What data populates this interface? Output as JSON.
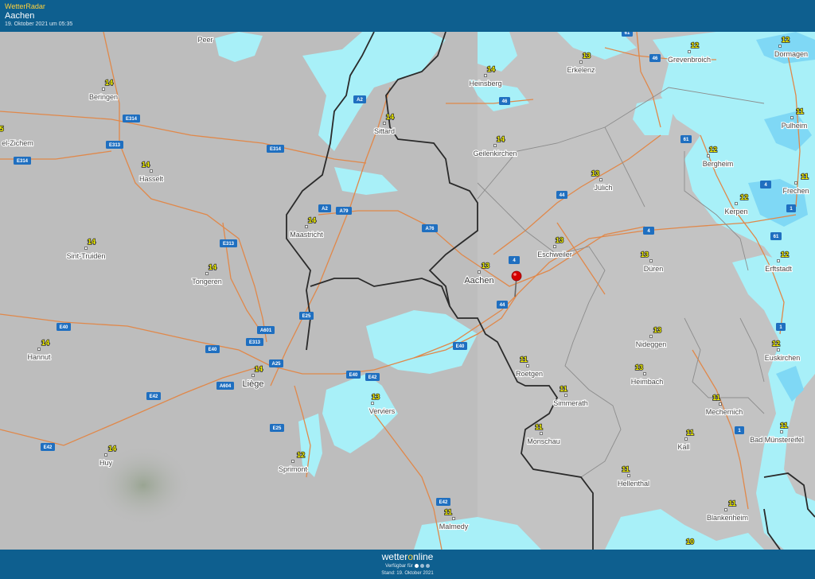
{
  "header": {
    "brand": "WetterRadar",
    "city": "Aachen",
    "date": "19. Oktober 2021 um 05:35"
  },
  "footer": {
    "logo_pre": "wetter",
    "logo_o": "o",
    "logo_post": "nline",
    "available": "Verfügbar für",
    "stand": "Stand: 19. Oktober 2021"
  },
  "colors": {
    "header_bg": "#0e5f8f",
    "rain_light": "#a8f0f8",
    "rain_medium": "#7fd8f5",
    "border": "#2a2a2a",
    "road": "#e0884a",
    "marker": "#d40000"
  },
  "cities": [
    {
      "id": "peer",
      "name": "Peer",
      "temp": ""
    },
    {
      "id": "beringen",
      "name": "Beringen",
      "temp": "14"
    },
    {
      "id": "zichem",
      "name": "el-Zichem",
      "temp": "5"
    },
    {
      "id": "hasselt",
      "name": "Hasselt",
      "temp": "14"
    },
    {
      "id": "sint-truiden",
      "name": "Sint-Truiden",
      "temp": "14"
    },
    {
      "id": "tongeren",
      "name": "Tongeren",
      "temp": "14"
    },
    {
      "id": "maastricht",
      "name": "Maastricht",
      "temp": "14"
    },
    {
      "id": "hannut",
      "name": "Hannut",
      "temp": "14"
    },
    {
      "id": "liege",
      "name": "Liège",
      "temp": "14"
    },
    {
      "id": "huy",
      "name": "Huy",
      "temp": "14"
    },
    {
      "id": "verviers",
      "name": "Verviers",
      "temp": "13"
    },
    {
      "id": "sprimont",
      "name": "Sprimont",
      "temp": "12"
    },
    {
      "id": "malmedy",
      "name": "Malmedy",
      "temp": "11"
    },
    {
      "id": "sittard",
      "name": "Sittard",
      "temp": "14"
    },
    {
      "id": "heinsberg",
      "name": "Heinsberg",
      "temp": "14"
    },
    {
      "id": "geilenkirchen",
      "name": "Geilenkirchen",
      "temp": "14"
    },
    {
      "id": "erkelenz",
      "name": "Erkelenz",
      "temp": "13"
    },
    {
      "id": "grevenbroich",
      "name": "Grevenbroich",
      "temp": "12"
    },
    {
      "id": "dormagen",
      "name": "Dormagen",
      "temp": "12"
    },
    {
      "id": "pulheim",
      "name": "Pulheim",
      "temp": "11"
    },
    {
      "id": "bergheim",
      "name": "Bergheim",
      "temp": "12"
    },
    {
      "id": "frechen",
      "name": "Frechen",
      "temp": "11"
    },
    {
      "id": "kerpen",
      "name": "Kerpen",
      "temp": "12"
    },
    {
      "id": "juelich",
      "name": "Jülich",
      "temp": "13"
    },
    {
      "id": "aachen",
      "name": "Aachen",
      "temp": "13"
    },
    {
      "id": "eschweiler",
      "name": "Eschweiler",
      "temp": "13"
    },
    {
      "id": "dueren",
      "name": "Düren",
      "temp": "13"
    },
    {
      "id": "erftstadt",
      "name": "Erftstadt",
      "temp": "12"
    },
    {
      "id": "nideggen",
      "name": "Nideggen",
      "temp": "13"
    },
    {
      "id": "roetgen",
      "name": "Roetgen",
      "temp": "11"
    },
    {
      "id": "simmerath",
      "name": "Simmerath",
      "temp": "11"
    },
    {
      "id": "heimbach",
      "name": "Heimbach",
      "temp": "13"
    },
    {
      "id": "euskirchen",
      "name": "Euskirchen",
      "temp": "12"
    },
    {
      "id": "monschau",
      "name": "Monschau",
      "temp": "11"
    },
    {
      "id": "mechernich",
      "name": "Mechernich",
      "temp": "11"
    },
    {
      "id": "kall",
      "name": "Kall",
      "temp": "11"
    },
    {
      "id": "bad-muenstereifel",
      "name": "Bad Münstereifel",
      "temp": "11"
    },
    {
      "id": "hellenthal",
      "name": "Hellenthal",
      "temp": "11"
    },
    {
      "id": "blankenheim",
      "name": "Blankenheim",
      "temp": "11"
    },
    {
      "id": "bottom",
      "name": "",
      "temp": "10"
    }
  ],
  "roads": [
    {
      "id": "a2-n",
      "label": "A2",
      "color": "#1f6fc0"
    },
    {
      "id": "a2-m",
      "label": "A2",
      "color": "#1f6fc0"
    },
    {
      "id": "a79",
      "label": "A79",
      "color": "#1f6fc0"
    },
    {
      "id": "a76",
      "label": "A76",
      "color": "#1f6fc0"
    },
    {
      "id": "e314-a",
      "label": "E314",
      "color": "#1f6fc0"
    },
    {
      "id": "e314-b",
      "label": "E314",
      "color": "#1f6fc0"
    },
    {
      "id": "e314-c",
      "label": "E314",
      "color": "#1f6fc0"
    },
    {
      "id": "e313-a",
      "label": "E313",
      "color": "#1f6fc0"
    },
    {
      "id": "e313-b",
      "label": "E313",
      "color": "#1f6fc0"
    },
    {
      "id": "e313-c",
      "label": "E313",
      "color": "#1f6fc0"
    },
    {
      "id": "e25-a",
      "label": "E25",
      "color": "#1f6fc0"
    },
    {
      "id": "e25-b",
      "label": "E25",
      "color": "#1f6fc0"
    },
    {
      "id": "a601",
      "label": "A601",
      "color": "#1f6fc0"
    },
    {
      "id": "a25",
      "label": "A25",
      "color": "#1f6fc0"
    },
    {
      "id": "a604",
      "label": "A604",
      "color": "#1f6fc0"
    },
    {
      "id": "e40-a",
      "label": "E40",
      "color": "#1f6fc0"
    },
    {
      "id": "e40-b",
      "label": "E40",
      "color": "#1f6fc0"
    },
    {
      "id": "e40-c",
      "label": "E40",
      "color": "#1f6fc0"
    },
    {
      "id": "e40-d",
      "label": "E40",
      "color": "#1f6fc0"
    },
    {
      "id": "e42-a",
      "label": "E42",
      "color": "#1f6fc0"
    },
    {
      "id": "e42-b",
      "label": "E42",
      "color": "#1f6fc0"
    },
    {
      "id": "e42-c",
      "label": "E42",
      "color": "#1f6fc0"
    },
    {
      "id": "e42-d",
      "label": "E42",
      "color": "#1f6fc0"
    },
    {
      "id": "a4-a",
      "label": "4",
      "color": "#1f6fc0"
    },
    {
      "id": "a4-b",
      "label": "4",
      "color": "#1f6fc0"
    },
    {
      "id": "a4-c",
      "label": "4",
      "color": "#1f6fc0"
    },
    {
      "id": "a44-a",
      "label": "44",
      "color": "#1f6fc0"
    },
    {
      "id": "a44-b",
      "label": "44",
      "color": "#1f6fc0"
    },
    {
      "id": "a46-a",
      "label": "46",
      "color": "#1f6fc0"
    },
    {
      "id": "a46-b",
      "label": "46",
      "color": "#1f6fc0"
    },
    {
      "id": "a61-a",
      "label": "61",
      "color": "#1f6fc0"
    },
    {
      "id": "a61-b",
      "label": "61",
      "color": "#1f6fc0"
    },
    {
      "id": "a61-c",
      "label": "61",
      "color": "#1f6fc0"
    },
    {
      "id": "a1-a",
      "label": "1",
      "color": "#1f6fc0"
    },
    {
      "id": "a1-b",
      "label": "1",
      "color": "#1f6fc0"
    },
    {
      "id": "a1-c",
      "label": "1",
      "color": "#1f6fc0"
    }
  ],
  "marker": {
    "icon": "map-pin-icon"
  }
}
